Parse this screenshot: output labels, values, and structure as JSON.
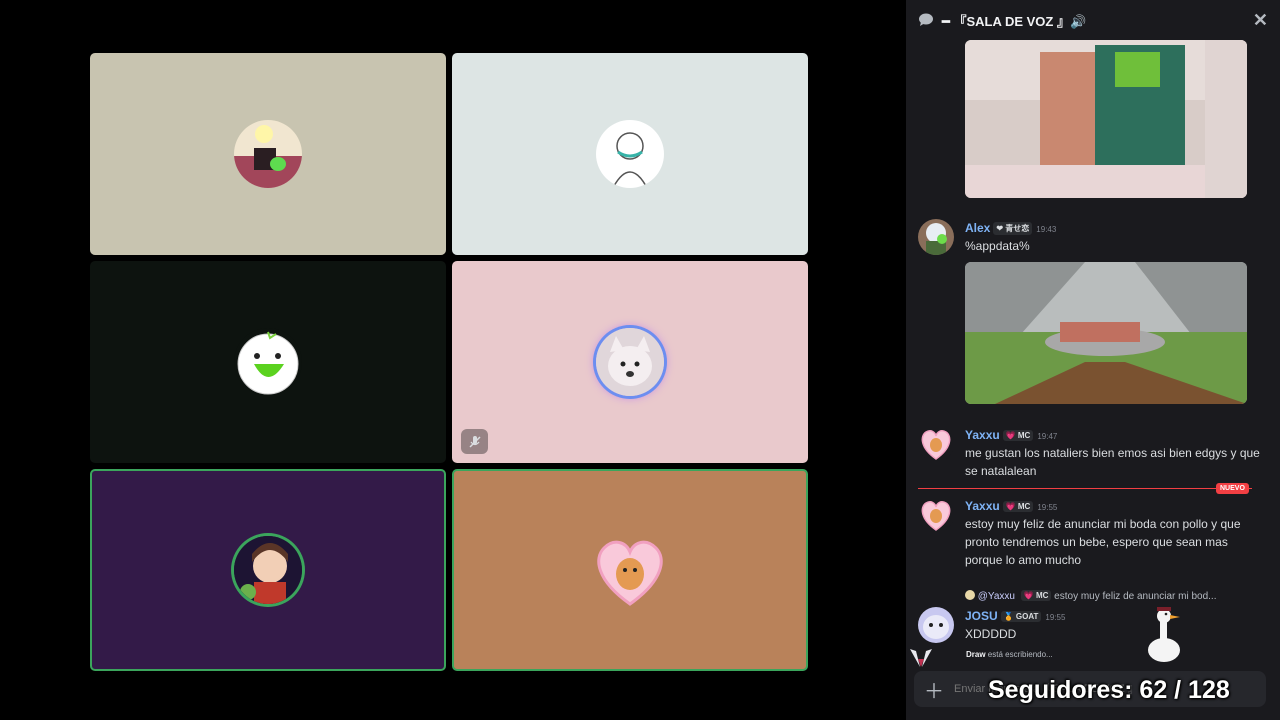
{
  "voice_tiles": [
    {
      "name": "participant-1",
      "bg": "#c8c4b0",
      "speaking": false,
      "muted": false
    },
    {
      "name": "participant-2",
      "bg": "#dde5e4",
      "speaking": false,
      "muted": false
    },
    {
      "name": "participant-3",
      "bg": "#0d130f",
      "speaking": false,
      "muted": false
    },
    {
      "name": "participant-4",
      "bg": "#e9c9cc",
      "speaking": false,
      "muted": true
    },
    {
      "name": "participant-5",
      "bg": "#331a48",
      "speaking": true,
      "muted": false
    },
    {
      "name": "participant-6",
      "bg": "#b9825a",
      "speaking": true,
      "muted": false
    }
  ],
  "chat": {
    "header_title": "━ 『SALA DE VOZ 』🔊",
    "close_icon": "close-icon",
    "messages": [
      {
        "user": "Alex",
        "tag": "❤ 青せ恋",
        "time": "19:43",
        "text": "%appdata%"
      },
      {
        "user": "Yaxxu",
        "tag": "💗 MC",
        "time": "19:47",
        "text": "me gustan los nataliers bien emos asi bien edgys y que se natalalean"
      },
      {
        "user": "Yaxxu",
        "tag": "💗 MC",
        "time": "19:55",
        "text": "estoy muy feliz de anunciar mi boda con pollo y que pronto tendremos un bebe, espero que sean mas porque lo amo mucho"
      },
      {
        "user": "JOSU",
        "tag": "🏅 GOAT",
        "time": "19:55",
        "text": "XDDDDD"
      }
    ],
    "new_label": "NUEVO",
    "reply_preview": {
      "mention": "@Yaxxu",
      "tag": "💗 MC",
      "text": "estoy muy feliz de anunciar mi bod..."
    },
    "typing": {
      "user": "Draw",
      "suffix": " está escribiendo..."
    },
    "composer_placeholder": "Enviar mensaje a 『SALA DE VOZ 』"
  },
  "overlay": {
    "followers_text": "Seguidores: 62 / 128"
  },
  "colors": {
    "speaking": "#3ba55c",
    "username": "#7fb3f5",
    "new": "#f23f43",
    "panel": "#1a1a1e"
  }
}
